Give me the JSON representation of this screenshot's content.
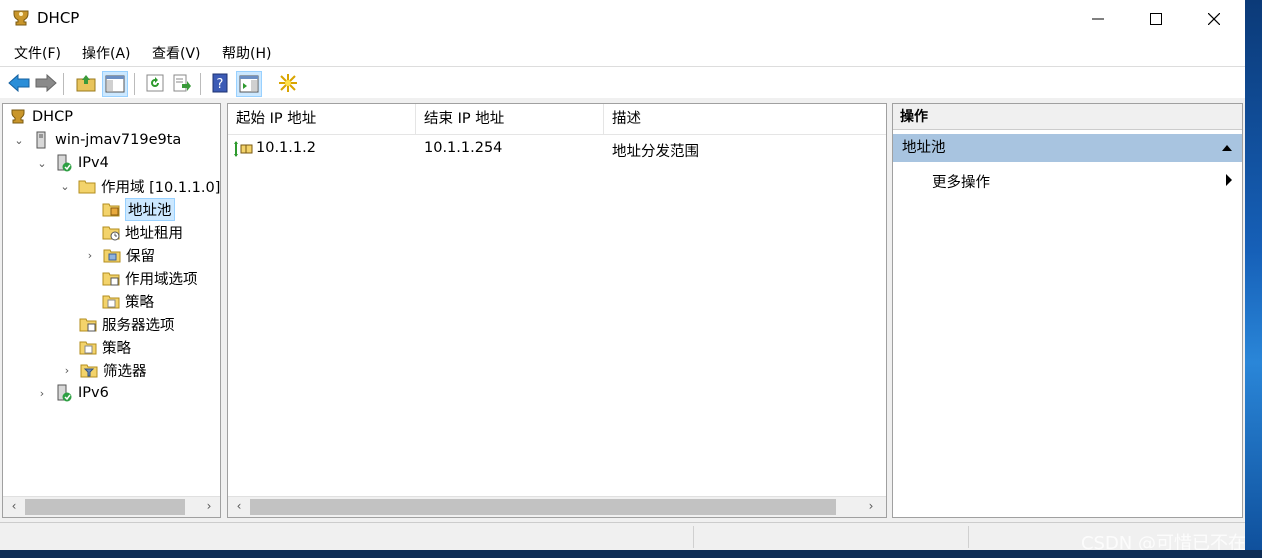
{
  "window": {
    "title": "DHCP"
  },
  "menu": [
    "文件(F)",
    "操作(A)",
    "查看(V)",
    "帮助(H)"
  ],
  "tree": {
    "root": "DHCP",
    "server": "win-jmav719e9ta",
    "ipv4": "IPv4",
    "scope": "作用域 [10.1.1.0]",
    "pool": "地址池",
    "leases": "地址租用",
    "reservations": "保留",
    "scope_options": "作用域选项",
    "scope_policies": "策略",
    "server_options": "服务器选项",
    "policies": "策略",
    "filters": "筛选器",
    "ipv6": "IPv6"
  },
  "list": {
    "columns": [
      "起始 IP 地址",
      "结束 IP 地址",
      "描述"
    ],
    "rows": [
      {
        "start": "10.1.1.2",
        "end": "10.1.1.254",
        "desc": "地址分发范围"
      }
    ]
  },
  "actions": {
    "title": "操作",
    "section": "地址池",
    "more": "更多操作"
  },
  "watermark": "CSDN @可惜已不在"
}
